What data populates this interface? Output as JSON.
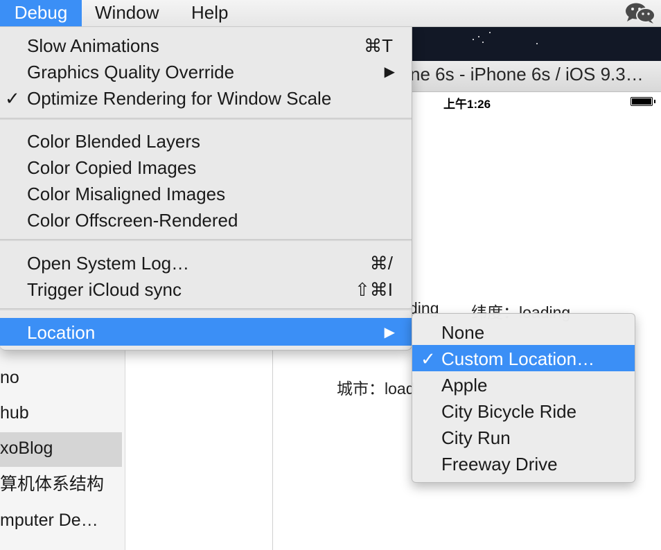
{
  "menubar": {
    "debug": "Debug",
    "window": "Window",
    "help": "Help"
  },
  "sidebar": {
    "items": [
      {
        "label": "no",
        "selected": false
      },
      {
        "label": "hub",
        "selected": false
      },
      {
        "label": "xoBlog",
        "selected": true
      },
      {
        "label": "算机体系结构",
        "selected": false
      },
      {
        "label": "mputer De…",
        "selected": false
      }
    ]
  },
  "simulator": {
    "window_title": "ne 6s - iPhone 6s / iOS 9.3…",
    "status_time": "上午1:26",
    "app": {
      "longitude_fragment": "ding",
      "latitude": "纬度：loading",
      "city": "城市：load"
    }
  },
  "debug_menu": {
    "items": [
      {
        "label": "Slow Animations",
        "shortcut": "⌘T"
      },
      {
        "label": "Graphics Quality Override",
        "submenu_arrow": "▶"
      },
      {
        "label": "Optimize Rendering for Window Scale",
        "check": "✓"
      },
      {
        "label": "Color Blended Layers"
      },
      {
        "label": "Color Copied Images"
      },
      {
        "label": "Color Misaligned Images"
      },
      {
        "label": "Color Offscreen-Rendered"
      },
      {
        "label": "Open System Log…",
        "shortcut": "⌘/"
      },
      {
        "label": "Trigger iCloud sync",
        "shortcut": "⇧⌘I"
      },
      {
        "label": "Location",
        "submenu_arrow": "▶",
        "highlighted": true
      }
    ]
  },
  "location_menu": {
    "check": "✓",
    "items": [
      {
        "label": "None"
      },
      {
        "label": "Custom Location…",
        "checked": true,
        "highlighted": true
      },
      {
        "label": "Apple"
      },
      {
        "label": "City Bicycle Ride"
      },
      {
        "label": "City Run"
      },
      {
        "label": "Freeway Drive"
      }
    ]
  },
  "colors": {
    "highlight": "#3b8ff6",
    "menu_bg": "#e8e8e8"
  },
  "icons": {
    "menubar_right": "wechat-icon"
  }
}
